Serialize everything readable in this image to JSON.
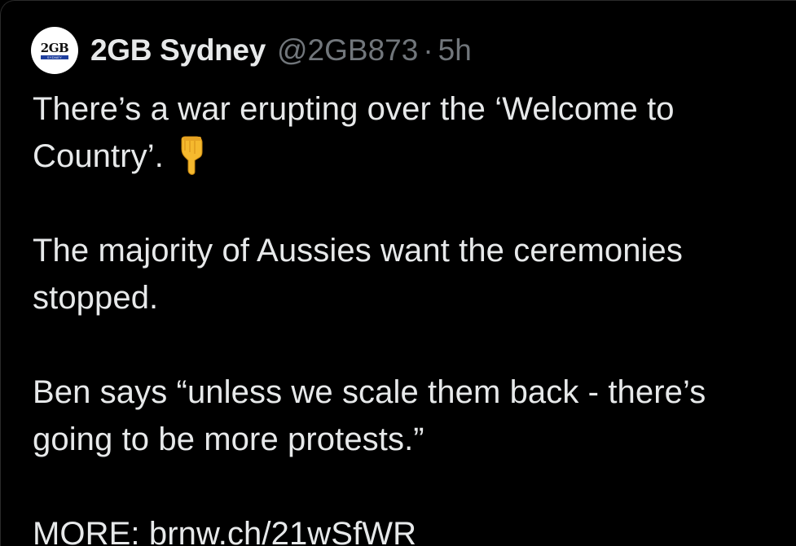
{
  "tweet": {
    "avatar": {
      "logo_text": "2GB",
      "logo_subtext": "SYDNEY"
    },
    "display_name": "2GB Sydney",
    "handle": "@2GB873",
    "separator": "·",
    "timestamp": "5h",
    "body": {
      "line1": "There’s a war erupting over the ‘Welcome to Country’.",
      "emoji": "point-down-emoji",
      "para2": "The majority of Aussies want the ceremonies stopped.",
      "para3": "Ben says “unless we scale them back - there’s going to be more protests.”",
      "more_label": "MORE:",
      "link_text": "brnw.ch/21wSfWR"
    }
  },
  "colors": {
    "background": "#000000",
    "text_primary": "#e7e9ea",
    "text_secondary": "#71767b",
    "avatar_bg": "#ffffff",
    "avatar_bar": "#1f3f9e",
    "emoji_skin": "#f5b92e"
  }
}
